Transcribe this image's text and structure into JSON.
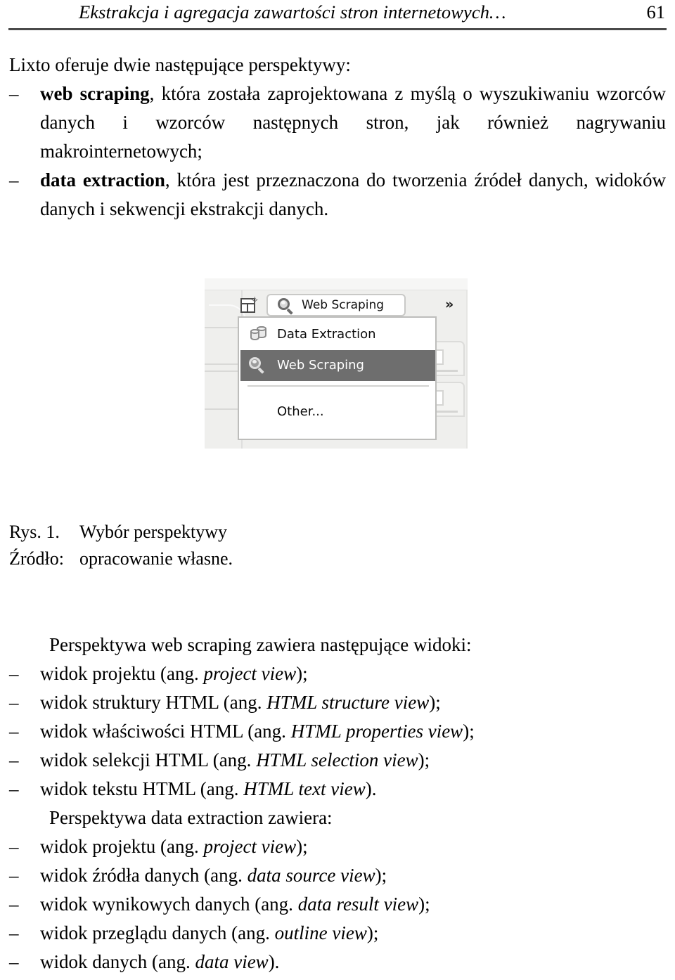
{
  "header": {
    "title": "Ekstrakcja i agregacja zawartości stron internetowych…",
    "page_number": "61"
  },
  "body": {
    "lead": "Lixto oferuje dwie następujące perspektywy:",
    "perspective_list": [
      {
        "bullet": "–",
        "term": "web scraping",
        "rest": ", która została zaprojektowana z myślą o wyszukiwaniu wzorców danych i wzorców następnych stron, jak również nagrywaniu makrointernetowych;"
      },
      {
        "bullet": "–",
        "term": "data extraction",
        "rest": ", która jest przeznaczona do tworzenia źródeł danych, widoków danych i sekwencji ekstrakcji danych."
      }
    ],
    "views_intro_web": "Perspektywa web scraping zawiera następujące widoki:",
    "views_web": [
      {
        "bullet": "–",
        "pl": "widok projektu (ang. ",
        "en": "project view",
        "tail": ");"
      },
      {
        "bullet": "–",
        "pl": "widok struktury HTML (ang. ",
        "en": "HTML structure view",
        "tail": ");"
      },
      {
        "bullet": "–",
        "pl": "widok właściwości HTML (ang. ",
        "en": "HTML properties view",
        "tail": ");"
      },
      {
        "bullet": "–",
        "pl": "widok selekcji HTML (ang. ",
        "en": "HTML selection view",
        "tail": ");"
      },
      {
        "bullet": "–",
        "pl": "widok tekstu HTML (ang. ",
        "en": "HTML text view",
        "tail": ")."
      }
    ],
    "views_intro_data": "Perspektywa data extraction zawiera:",
    "views_data": [
      {
        "bullet": "–",
        "pl": "widok projektu (ang. ",
        "en": "project view",
        "tail": ");"
      },
      {
        "bullet": "–",
        "pl": "widok źródła danych (ang. ",
        "en": "data source view",
        "tail": ");"
      },
      {
        "bullet": "–",
        "pl": "widok wynikowych danych (ang. ",
        "en": "data result view",
        "tail": ");"
      },
      {
        "bullet": "–",
        "pl": "widok przeglądu danych (ang. ",
        "en": "outline view",
        "tail": ");"
      },
      {
        "bullet": "–",
        "pl": "widok danych (ang. ",
        "en": "data view",
        "tail": ")."
      }
    ]
  },
  "figure": {
    "caption_number": "Rys. 1.",
    "caption_text": "Wybór perspektywy",
    "source_label": "Źródło:",
    "source_text": "opracowanie własne.",
    "screenshot": {
      "new_perspective_icon": "new-perspective-icon",
      "active_perspective": "Web Scraping",
      "overflow_chevron": "»",
      "menu_items": [
        {
          "label": "Data Extraction",
          "icon": "database-icon",
          "selected": false
        },
        {
          "label": "Web Scraping",
          "icon": "magnifier-icon",
          "selected": true
        },
        {
          "label": "Other...",
          "icon": "none",
          "selected": false
        }
      ],
      "colors": {
        "toolbar_bg": "#efefed",
        "menu_bg": "#ffffff",
        "selection_bg": "#6e6e6e",
        "selection_fg": "#ffffff"
      }
    }
  }
}
